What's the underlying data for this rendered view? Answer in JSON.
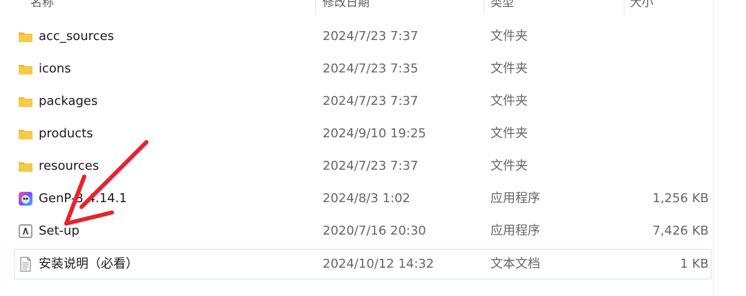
{
  "header": {
    "name": "名称",
    "date": "修改日期",
    "type": "类型",
    "size": "大小"
  },
  "files": [
    {
      "name": "acc_sources",
      "date": "2024/7/23 7:37",
      "type": "文件夹",
      "size": "",
      "icon": "folder-icon"
    },
    {
      "name": "icons",
      "date": "2024/7/23 7:35",
      "type": "文件夹",
      "size": "",
      "icon": "folder-icon"
    },
    {
      "name": "packages",
      "date": "2024/7/23 7:37",
      "type": "文件夹",
      "size": "",
      "icon": "folder-icon"
    },
    {
      "name": "products",
      "date": "2024/9/10 19:25",
      "type": "文件夹",
      "size": "",
      "icon": "folder-icon"
    },
    {
      "name": "resources",
      "date": "2024/7/23 7:37",
      "type": "文件夹",
      "size": "",
      "icon": "folder-icon"
    },
    {
      "name": "GenP-3.4.14.1",
      "date": "2024/8/3 1:02",
      "type": "应用程序",
      "size": "1,256 KB",
      "icon": "genp-app-icon"
    },
    {
      "name": "Set-up",
      "date": "2020/7/16 20:30",
      "type": "应用程序",
      "size": "7,426 KB",
      "icon": "adobe-setup-icon"
    },
    {
      "name": "安装说明（必看）",
      "date": "2024/10/12 14:32",
      "type": "文本文档",
      "size": "1 KB",
      "icon": "text-document-icon"
    }
  ],
  "colors": {
    "folder": "#f7c948",
    "arrow": "#e8232b",
    "selection_border": "#cfe6f3"
  }
}
